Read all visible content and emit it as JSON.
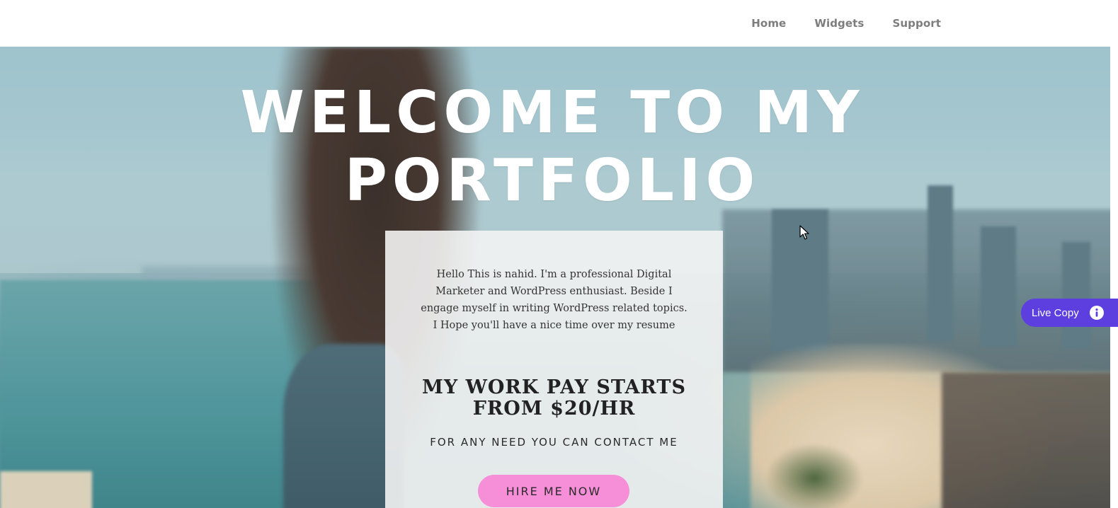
{
  "nav": {
    "items": [
      {
        "label": "Home"
      },
      {
        "label": "Widgets"
      },
      {
        "label": "Support"
      }
    ]
  },
  "hero": {
    "title_line1": "WELCOME TO MY",
    "title_line2": "PORTFOLIO"
  },
  "card": {
    "intro_lines": [
      "Hello This is nahid. I'm a professional Digital",
      "Marketer and WordPress enthusiast. Beside I",
      "engage myself in writing WordPress related topics.",
      "I Hope you'll have a nice time over my resume"
    ],
    "pay_line1": "MY WORK PAY STARTS",
    "pay_line2": "FROM $20/HR",
    "contact": "FOR ANY NEED YOU CAN CONTACT ME",
    "button_label": "HIRE ME NOW"
  },
  "live_copy": {
    "label": "Live Copy",
    "icon": "info-icon"
  },
  "colors": {
    "button_pink": "#f68fd8",
    "live_copy_purple": "#5d3fe0",
    "nav_text": "#7d7d7d"
  }
}
